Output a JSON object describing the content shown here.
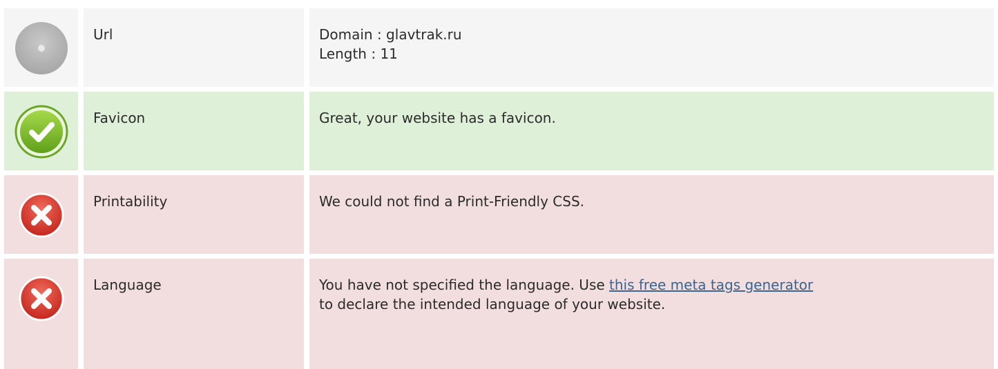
{
  "rows": [
    {
      "status": "neutral",
      "icon": "gray-disc-icon",
      "label": "Url",
      "lines": [
        "Domain : glavtrak.ru",
        "Length : 11"
      ]
    },
    {
      "status": "pass",
      "icon": "check-circle-icon",
      "label": "Favicon",
      "text": "Great, your website has a favicon."
    },
    {
      "status": "fail",
      "icon": "error-x-circle-icon",
      "label": "Printability",
      "text": "We could not find a Print-Friendly CSS."
    },
    {
      "status": "fail",
      "icon": "error-x-circle-icon",
      "label": "Language",
      "text_before": "You have not specified the language. Use ",
      "link_text": "this free meta tags generator",
      "text_after": "to declare the intended language of your website."
    }
  ],
  "colors": {
    "neutral_bg": "#f5f5f5",
    "pass_bg": "#dff0d8",
    "fail_bg": "#f2dede",
    "link": "#3a6590",
    "pass_icon": "#7fbf2a",
    "fail_icon": "#d9352a"
  }
}
